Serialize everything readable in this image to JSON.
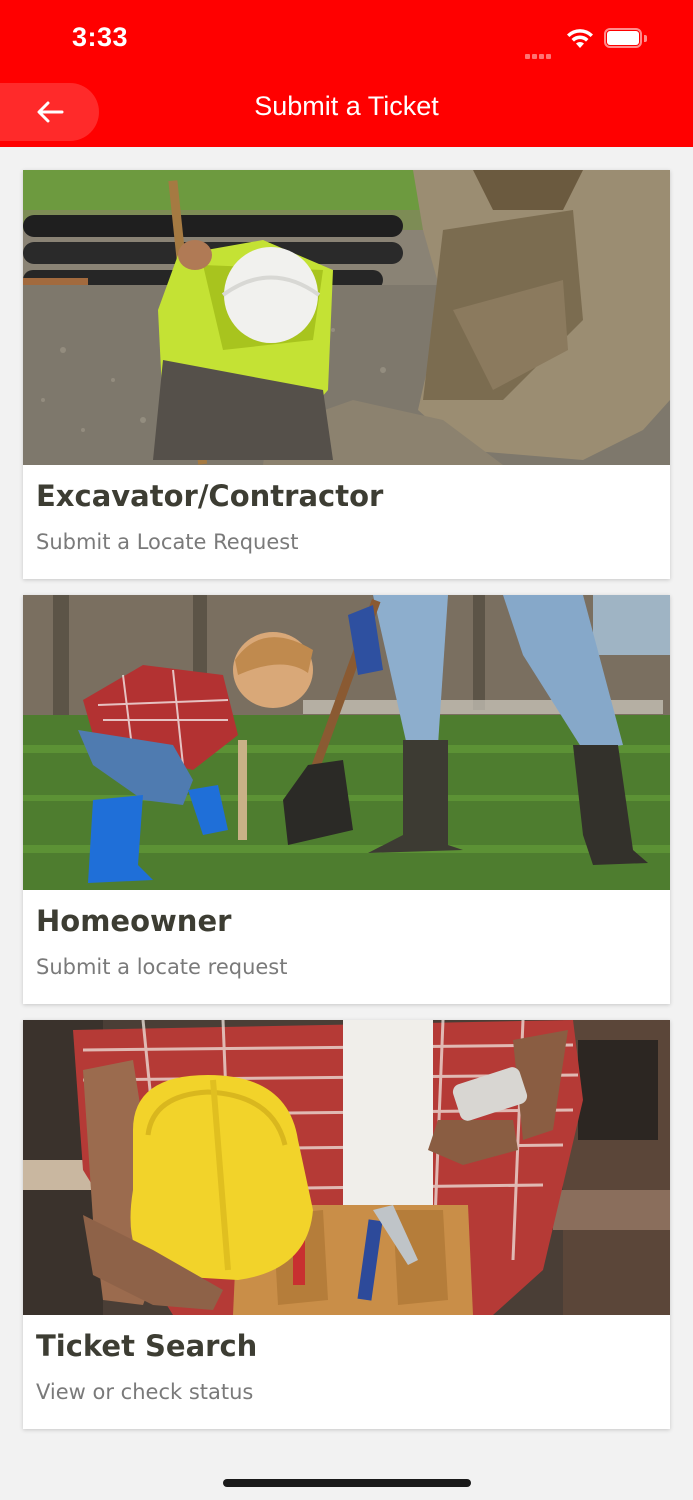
{
  "status_bar": {
    "time": "3:33",
    "icons": [
      "cellular-signal-icon",
      "wifi-icon",
      "battery-icon"
    ]
  },
  "nav": {
    "title": "Submit a Ticket",
    "back_icon": "arrow-left-icon"
  },
  "cards": [
    {
      "title": "Excavator/Contractor",
      "subtitle": "Submit a Locate Request",
      "image": "construction worker with hard hat digging beside excavator bucket"
    },
    {
      "title": "Homeowner",
      "subtitle": "Submit a locate request",
      "image": "child digging in grass beside adult with shovel"
    },
    {
      "title": "Ticket Search",
      "subtitle": "View or check status",
      "image": "worker holding yellow hard hat and phone with tool belt"
    }
  ],
  "colors": {
    "header_bg": "#ff0000",
    "back_button_bg": "#ff2a2a",
    "page_bg": "#f2f2f2",
    "card_title": "#3d3d33",
    "card_subtitle": "#7a7a7a"
  }
}
